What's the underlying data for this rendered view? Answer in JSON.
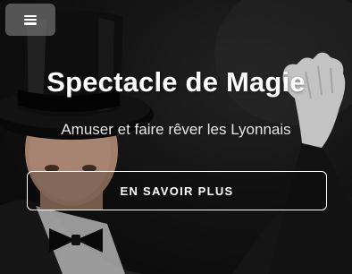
{
  "hero": {
    "title": "Spectacle de Magie",
    "subtitle": "Amuser et faire rêver les Lyonnais",
    "cta_label": "EN SAVOIR PLUS",
    "background_image": "magician-with-top-hat-photo"
  },
  "nav": {
    "menu_icon": "hamburger-menu-icon"
  },
  "colors": {
    "text": "#ffffff",
    "menu_button_bg": "#6e6e6e",
    "background": "#111111"
  }
}
